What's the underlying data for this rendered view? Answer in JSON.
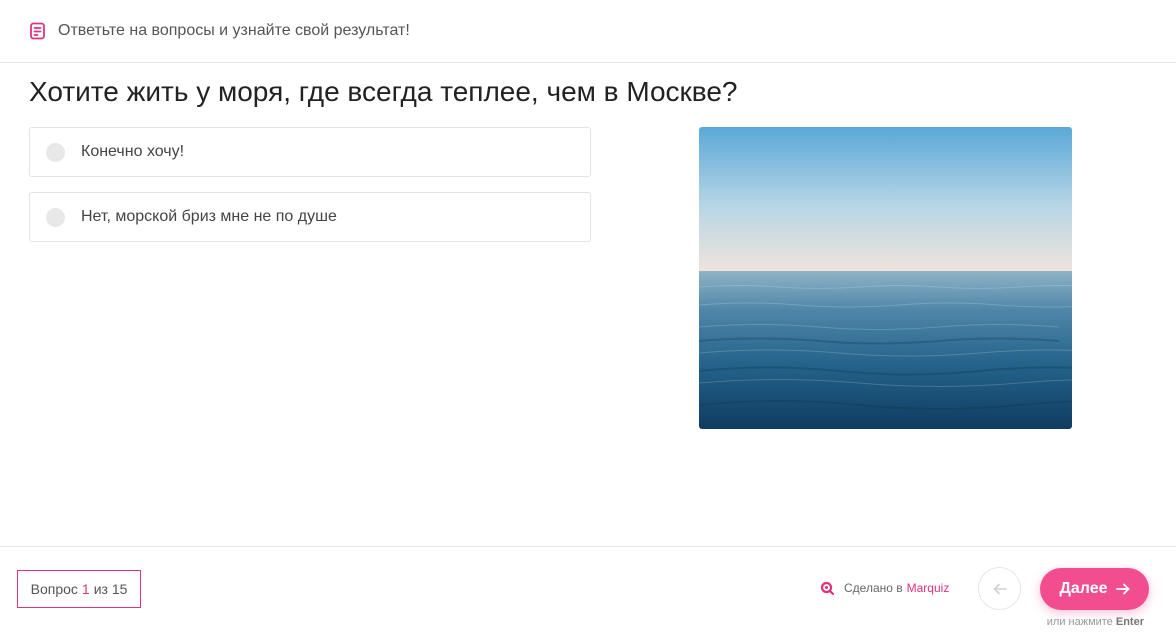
{
  "header": {
    "subtitle": "Ответьте на вопросы и узнайте свой результат!"
  },
  "question": {
    "title": "Хотите жить у моря, где всегда теплее, чем в Москве?",
    "options": [
      {
        "label": "Конечно хочу!"
      },
      {
        "label": "Нет, морской бриз мне не по душе"
      }
    ]
  },
  "footer": {
    "progress_prefix": "Вопрос",
    "progress_current": "1",
    "progress_suffix": "из 15",
    "made_in_prefix": "Сделано в",
    "made_in_brand": "Marquiz",
    "next_label": "Далее",
    "enter_hint_prefix": "или нажмите",
    "enter_hint_key": "Enter"
  },
  "icons": {
    "header": "quiz-list-icon",
    "brand": "marquiz-logo-icon",
    "back": "arrow-left-icon",
    "next": "arrow-right-icon"
  },
  "colors": {
    "accent": "#e0327d",
    "button": "#f24e8f"
  }
}
